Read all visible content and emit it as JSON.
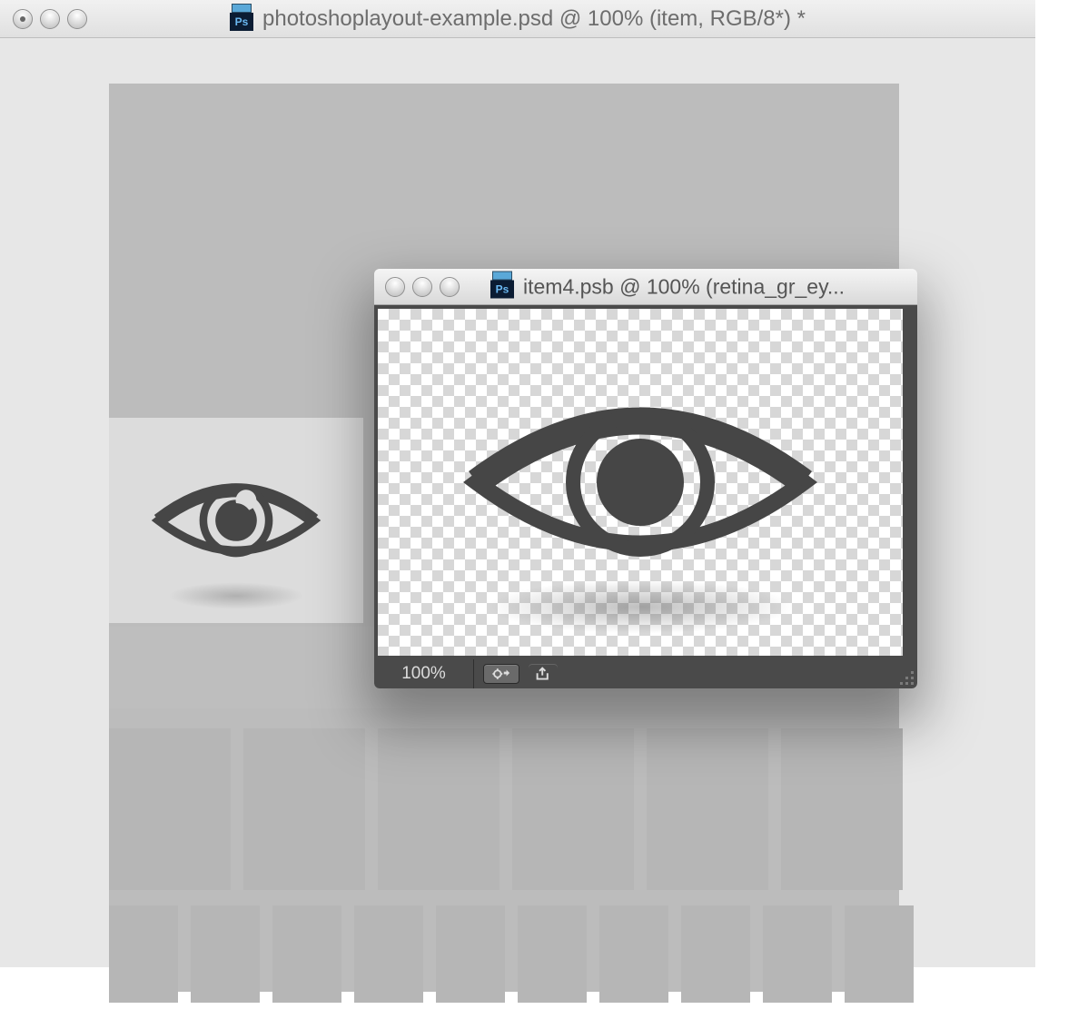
{
  "main_window": {
    "title": "photoshoplayout-example.psd @ 100% (item, RGB/8*) *",
    "ps_badge": "Ps"
  },
  "float_window": {
    "title": "item4.psb @ 100% (retina_gr_ey...",
    "ps_badge": "Ps",
    "zoom": "100%"
  },
  "icons": {
    "eye": "eye-icon",
    "gear": "gear-icon",
    "share": "share-icon"
  }
}
